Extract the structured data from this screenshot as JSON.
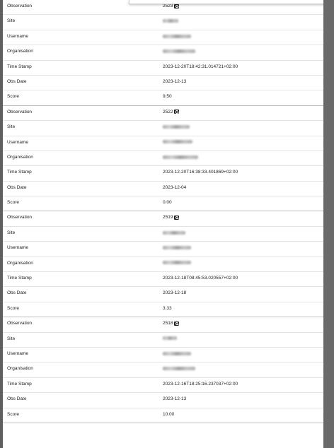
{
  "records": [
    {
      "observation": "2523",
      "time_stamp": "2023-12-20T18:42:31.014721+02:00",
      "obs_date": "2023-12-13",
      "score": "9.50"
    },
    {
      "observation": "2522",
      "time_stamp": "2023-12-20T16:38:33.401869+02:00",
      "obs_date": "2023-12-04",
      "score": "0.00"
    },
    {
      "observation": "2519",
      "time_stamp": "2023-12-18T08:45:53.020557+02:00",
      "obs_date": "2023-12-18",
      "score": "3.33"
    },
    {
      "observation": "2518",
      "time_stamp": "2023-12-16T18:25:16.237037+02:00",
      "obs_date": "2023-12-13",
      "score": "10.00"
    }
  ],
  "labels": {
    "observation": "Observation",
    "site": "Site",
    "username": "Username",
    "organisation": "Organisation",
    "time_stamp": "Time Stamp",
    "obs_date": "Obs Date",
    "score": "Score"
  },
  "icons": {
    "observation_link": "magnifier-icon"
  }
}
